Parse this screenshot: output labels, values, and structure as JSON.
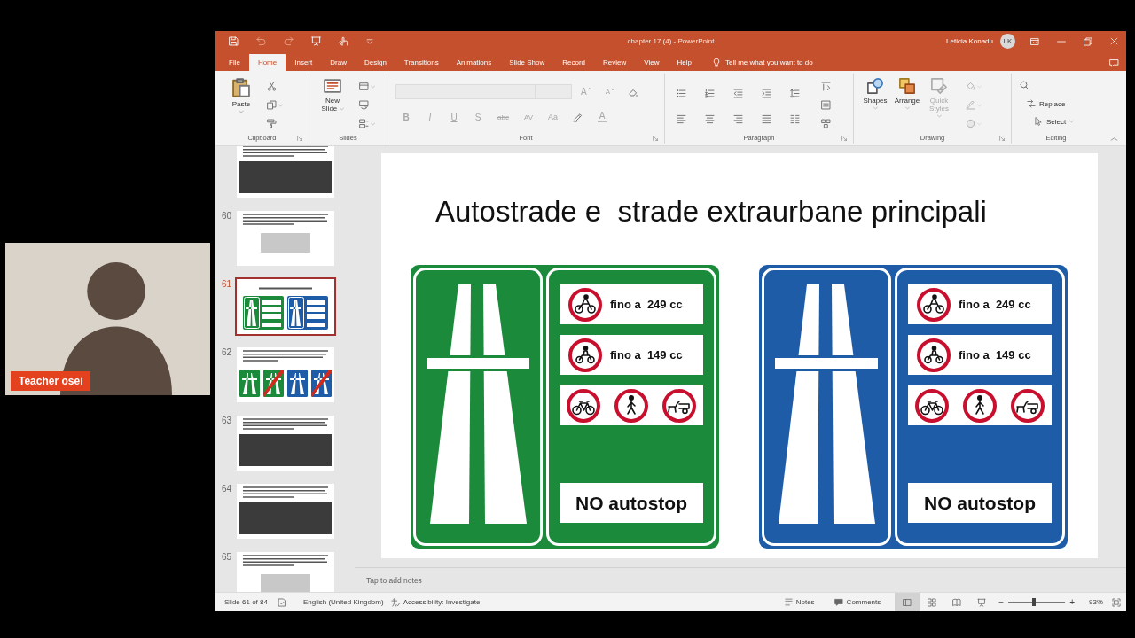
{
  "webcam": {
    "name_tag": "Teacher osei"
  },
  "window": {
    "title": "chapter 17 (4) - PowerPoint",
    "user_name": "Leticia Konadu",
    "user_initials": "LK"
  },
  "ribbon_tabs": [
    {
      "label": "File",
      "selected": false
    },
    {
      "label": "Home",
      "selected": true
    },
    {
      "label": "Insert",
      "selected": false
    },
    {
      "label": "Draw",
      "selected": false
    },
    {
      "label": "Design",
      "selected": false
    },
    {
      "label": "Transitions",
      "selected": false
    },
    {
      "label": "Animations",
      "selected": false
    },
    {
      "label": "Slide Show",
      "selected": false
    },
    {
      "label": "Record",
      "selected": false
    },
    {
      "label": "Review",
      "selected": false
    },
    {
      "label": "View",
      "selected": false
    },
    {
      "label": "Help",
      "selected": false
    }
  ],
  "tell_me": {
    "placeholder": "Tell me what you want to do"
  },
  "ribbon": {
    "clipboard": {
      "label": "Clipboard",
      "paste": "Paste"
    },
    "slides": {
      "label": "Slides",
      "new_slide": "New Slide"
    },
    "font": {
      "label": "Font",
      "size_buttons": [
        {
          "label": "A",
          "disabled": true
        },
        {
          "label": "A",
          "disabled": true
        }
      ],
      "buttons": [
        {
          "label": "B",
          "disabled": true
        },
        {
          "label": "I",
          "disabled": true
        },
        {
          "label": "U",
          "disabled": true
        },
        {
          "label": "S",
          "disabled": true
        },
        {
          "label": "abc",
          "disabled": true
        },
        {
          "label": "AV",
          "disabled": true
        },
        {
          "label": "Aa",
          "disabled": true
        },
        {
          "label": "A",
          "disabled": true
        }
      ]
    },
    "paragraph": {
      "label": "Paragraph"
    },
    "drawing": {
      "label": "Drawing",
      "tools": [
        {
          "label": "Shapes",
          "disabled": false
        },
        {
          "label": "Arrange",
          "disabled": false
        },
        {
          "label": "Quick Styles",
          "disabled": true
        }
      ]
    },
    "editing": {
      "label": "Editing",
      "tools": [
        "Replace",
        "Select"
      ]
    }
  },
  "thumbnails": [
    {
      "kind": "text_photo",
      "selected": false
    },
    {
      "number": "60",
      "kind": "text_sketch",
      "selected": false
    },
    {
      "number": "61",
      "kind": "title_signs",
      "selected": true
    },
    {
      "number": "62",
      "kind": "text_signs",
      "selected": false
    },
    {
      "number": "63",
      "kind": "text_photo",
      "selected": false
    },
    {
      "number": "64",
      "kind": "text_photo",
      "selected": false
    },
    {
      "number": "65",
      "kind": "text_sketch",
      "selected": false
    }
  ],
  "slide": {
    "title": "Autostrade e  strade extraurbane principali",
    "signs": [
      {
        "color": "#1b8a3a",
        "limits": [
          "fino a  249 cc",
          "fino a  149 cc"
        ],
        "footer": "NO autostop"
      },
      {
        "color": "#1e5ca8",
        "limits": [
          "fino a  249 cc",
          "fino a  149 cc"
        ],
        "footer": "NO autostop"
      }
    ]
  },
  "notes": {
    "placeholder": "Tap to add notes"
  },
  "status_bar": {
    "slide_position": "Slide 61 of 84",
    "language": "English (United Kingdom)",
    "accessibility": "Accessibility: Investigate",
    "notes": "Notes",
    "comments": "Comments",
    "views": [
      {
        "selected": true
      },
      {
        "selected": false
      },
      {
        "selected": false
      },
      {
        "selected": false
      }
    ],
    "zoom_out": "−",
    "zoom": {
      "level": 0.45
    },
    "zoom_in": "+",
    "zoom_percent": "93%"
  }
}
